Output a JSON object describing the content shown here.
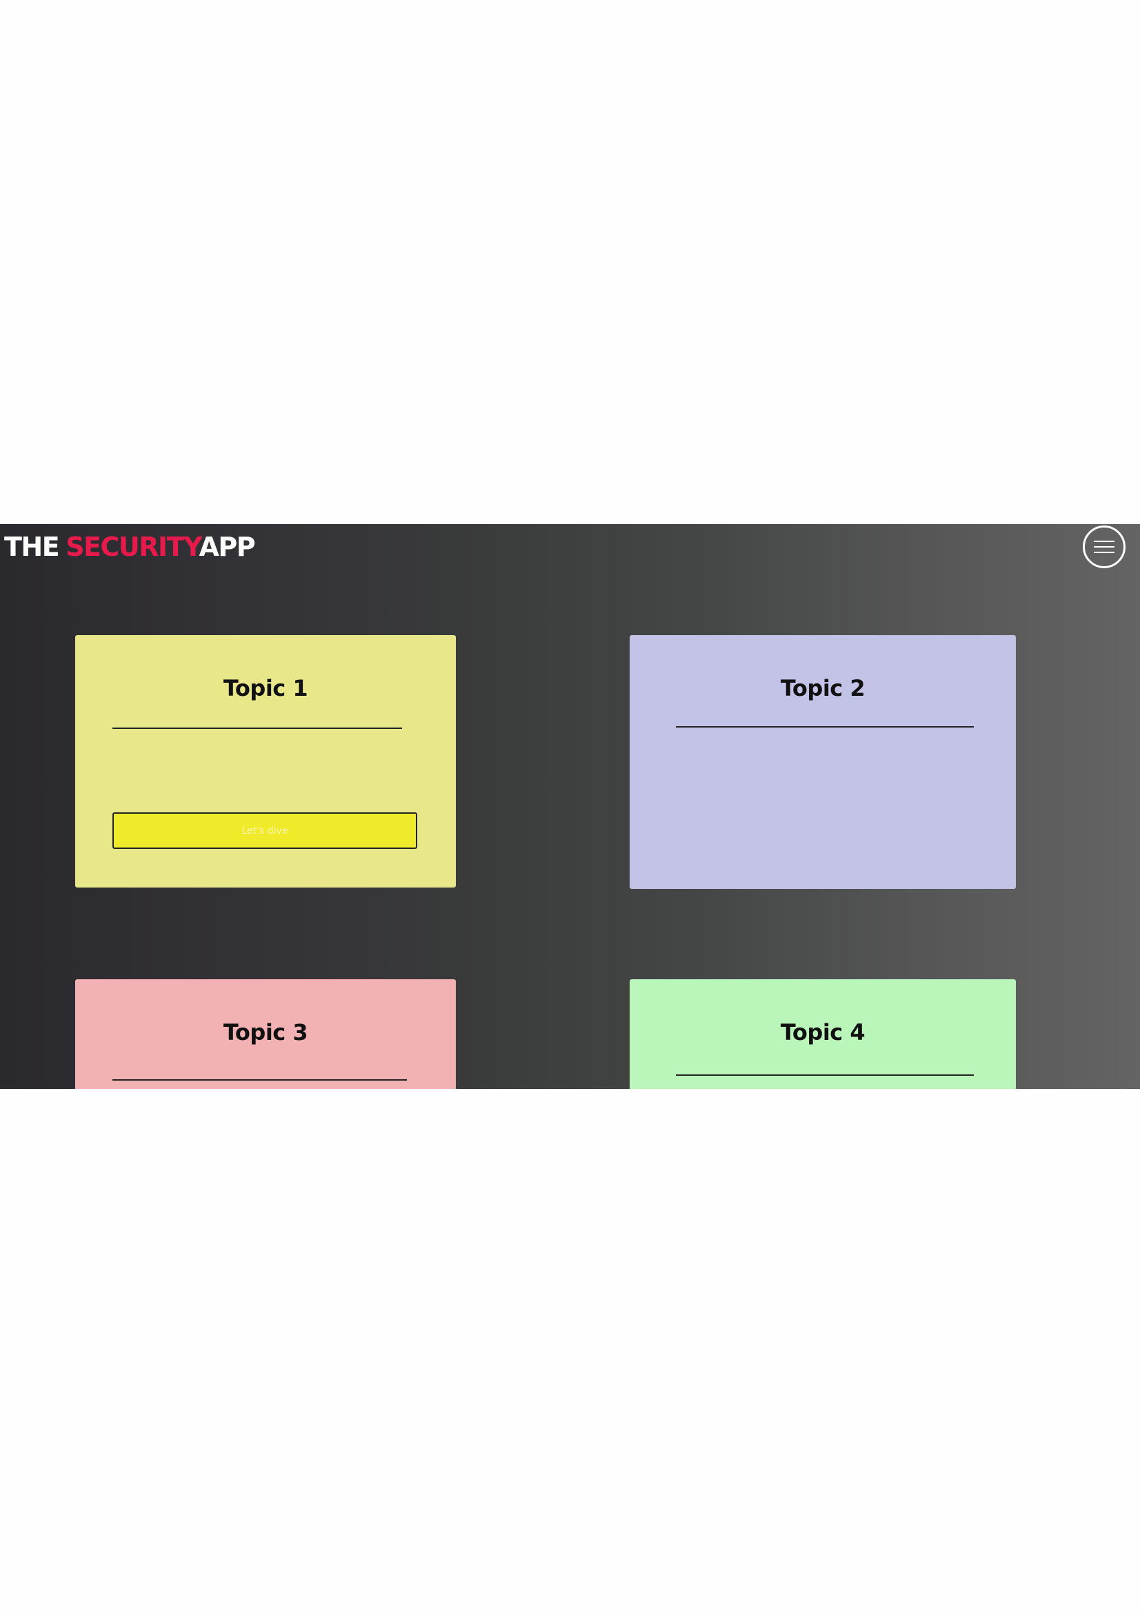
{
  "header": {
    "brand_part1": "THE",
    "brand_part2": "SECURITY",
    "brand_part3": "APP",
    "accent_color": "#e61b4c",
    "menu_icon": "hamburger-menu-icon"
  },
  "cards": [
    {
      "title": "Topic 1",
      "color": "#e8e88a",
      "button_label": "Let's dive"
    },
    {
      "title": "Topic 2",
      "color": "#c3c3e8"
    },
    {
      "title": "Topic 3",
      "color": "#f2b1b3"
    },
    {
      "title": "Topic 4",
      "color": "#baf5ba"
    }
  ]
}
